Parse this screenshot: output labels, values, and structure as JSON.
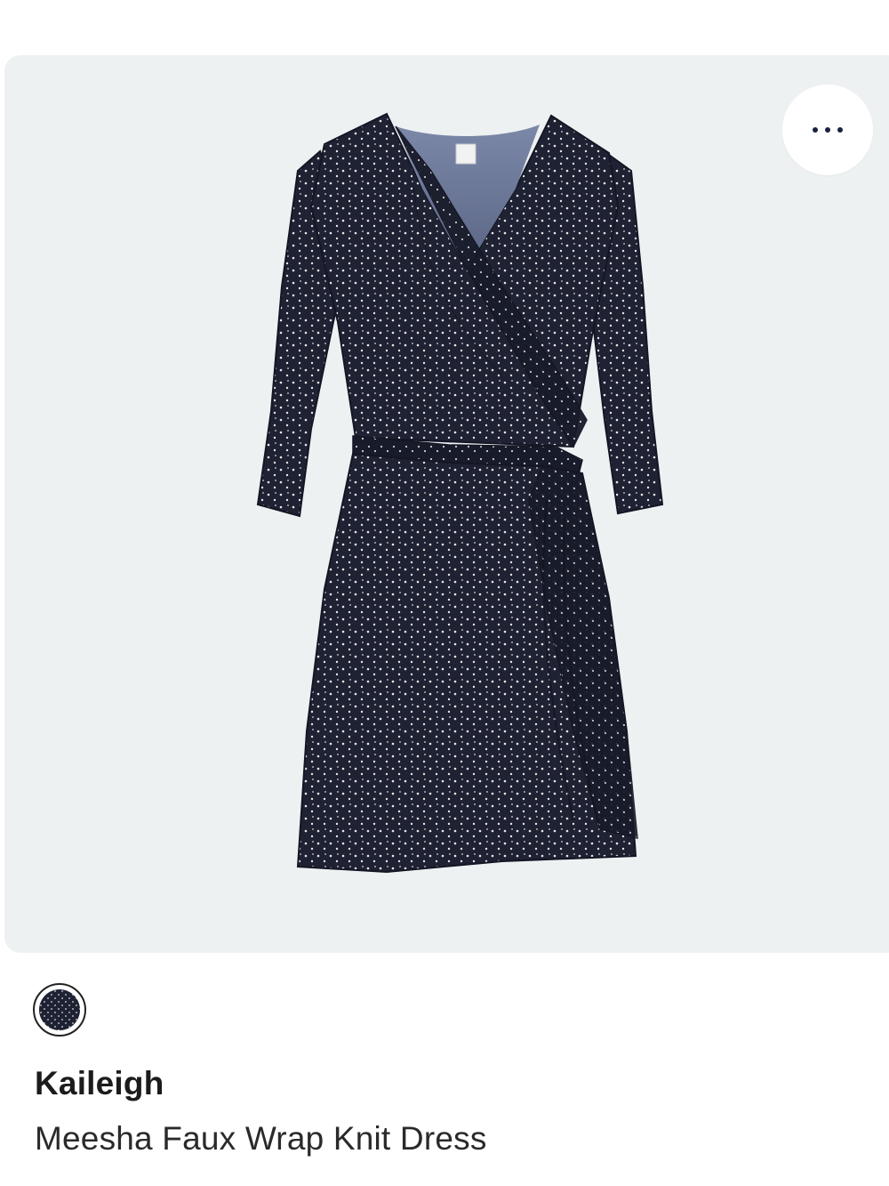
{
  "product": {
    "brand": "Kaileigh",
    "name": "Meesha Faux Wrap Knit Dress",
    "image_subject": "navy polka dot faux wrap dress with three-quarter sleeves",
    "swatch_color": "#1e2233",
    "card_background": "#eef1f2"
  },
  "actions": {
    "more_icon": "more-horizontal-icon"
  }
}
